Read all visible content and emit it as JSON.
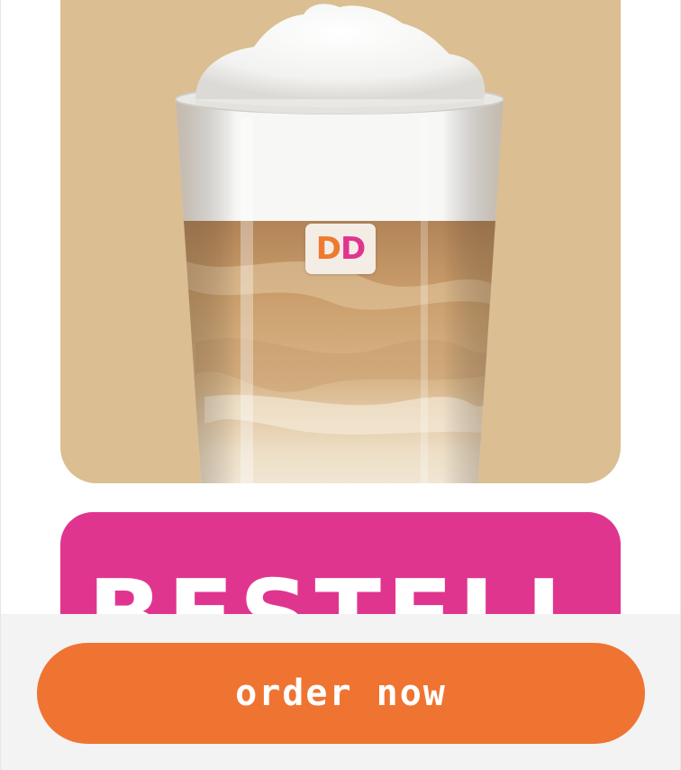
{
  "product": {
    "image_alt": "iced latte in a tall glass with milk foam",
    "brand_logo_letters": [
      "D",
      "D"
    ]
  },
  "promo": {
    "headline": "BESTELL"
  },
  "cta": {
    "label": "order now"
  },
  "colors": {
    "hero_background": "#dbbe91",
    "promo_pink": "#e0358f",
    "button_orange": "#ef7432",
    "bar_background": "#f3f3f3",
    "logo_orange": "#ef7a2e",
    "logo_pink": "#e0358f"
  }
}
